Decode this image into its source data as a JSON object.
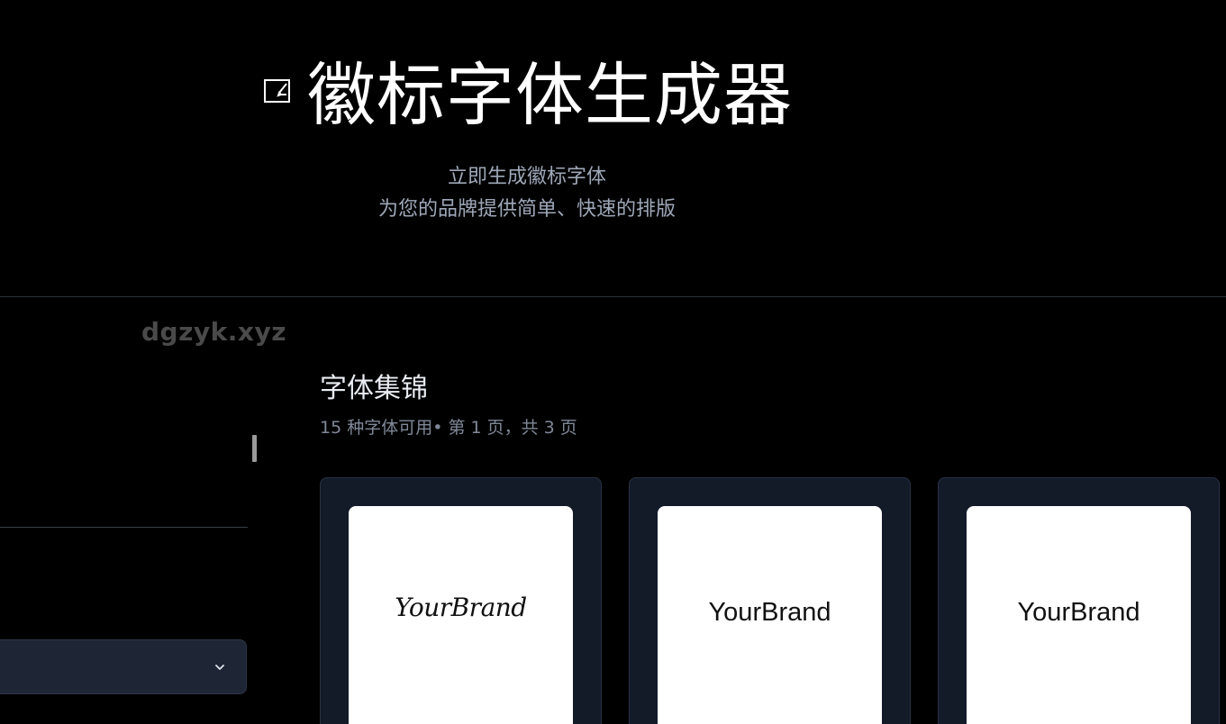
{
  "header": {
    "logo_icon": "edit-box-icon",
    "title": "徽标字体生成器",
    "subtitle_line1": "立即生成徽标字体",
    "subtitle_line2": "为您的品牌提供简单、快速的排版"
  },
  "sidebar": {
    "watermark": "dgzyk.xyz",
    "select_icon": "chevron-down-icon"
  },
  "gallery": {
    "title": "字体集锦",
    "meta": "15 种字体可用• 第 1 页，共 3 页",
    "cards": [
      {
        "preview_text": "YourBrand",
        "style": "script"
      },
      {
        "preview_text": "YourBrand",
        "style": "sans"
      },
      {
        "preview_text": "YourBrand",
        "style": "sans"
      }
    ]
  },
  "colors": {
    "background": "#000000",
    "card_bg": "#131a28",
    "select_bg": "#1e2636",
    "subtitle": "#9ea8b8",
    "meta": "#7f8898"
  }
}
